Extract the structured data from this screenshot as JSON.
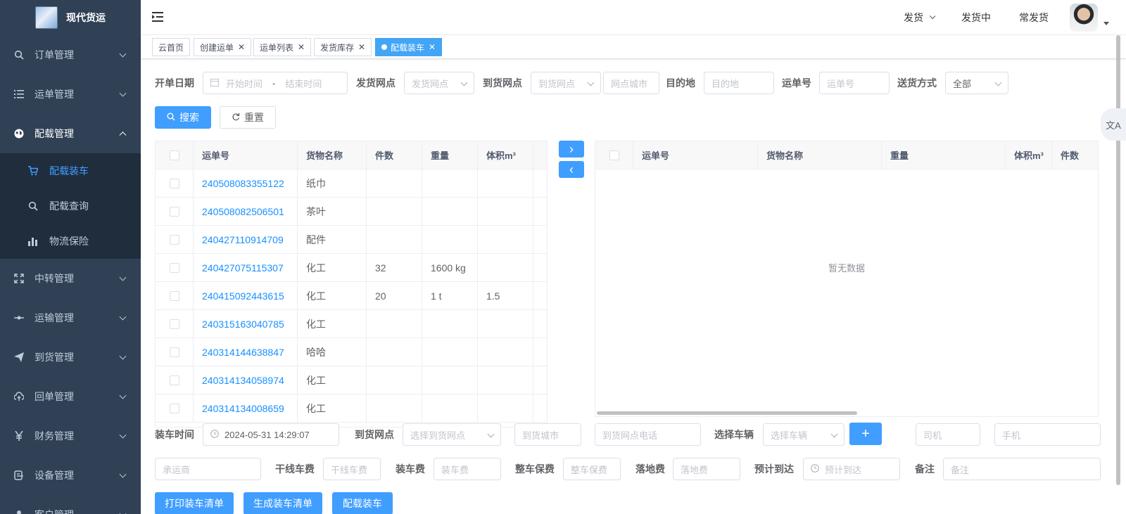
{
  "app": {
    "title": "现代货运"
  },
  "sidebar": {
    "items": [
      {
        "label": "订单管理",
        "icon": "search-icon"
      },
      {
        "label": "运单管理",
        "icon": "list-icon"
      },
      {
        "label": "配载管理",
        "icon": "globe-icon",
        "open": true,
        "children": [
          {
            "label": "配载装车",
            "icon": "cart-icon",
            "active": true
          },
          {
            "label": "配载查询",
            "icon": "search-icon"
          },
          {
            "label": "物流保险",
            "icon": "bar-chart-icon"
          }
        ]
      },
      {
        "label": "中转管理",
        "icon": "expand-icon"
      },
      {
        "label": "运输管理",
        "icon": "commit-icon"
      },
      {
        "label": "到货管理",
        "icon": "send-icon"
      },
      {
        "label": "回单管理",
        "icon": "cloud-return-icon"
      },
      {
        "label": "财务管理",
        "icon": "yen-icon"
      },
      {
        "label": "设备管理",
        "icon": "device-icon"
      },
      {
        "label": "客户管理",
        "icon": "user-icon"
      }
    ]
  },
  "navbar": {
    "links": [
      "发货",
      "发货中",
      "常发货"
    ]
  },
  "tags": [
    "云首页",
    "创建运单",
    "运单列表",
    "发货库存",
    "配载装车"
  ],
  "filters": {
    "date_label": "开单日期",
    "start_placeholder": "开始时间",
    "date_separator": "-",
    "end_placeholder": "结束时间",
    "send_point_label": "发货网点",
    "send_point_placeholder": "发货网点",
    "arrive_point_label": "到货网点",
    "arrive_point_placeholder": "到货网点",
    "point_city_placeholder": "网点城市",
    "dest_label": "目的地",
    "dest_placeholder": "目的地",
    "waybill_label": "运单号",
    "waybill_placeholder": "运单号",
    "delivery_label": "送货方式",
    "delivery_value": "全部",
    "search_btn": "搜索",
    "reset_btn": "重置"
  },
  "left_table": {
    "columns": [
      "运单号",
      "货物名称",
      "件数",
      "重量",
      "体积m³"
    ],
    "rows": [
      [
        "240508083355122",
        "纸巾",
        "",
        "",
        ""
      ],
      [
        "240508082506501",
        "茶叶",
        "",
        "",
        ""
      ],
      [
        "240427110914709",
        "配件",
        "",
        "",
        ""
      ],
      [
        "240427075115307",
        "化工",
        "32",
        "1600 kg",
        ""
      ],
      [
        "240415092443615",
        "化工",
        "20",
        "1 t",
        "1.5"
      ],
      [
        "240315163040785",
        "化工",
        "",
        "",
        ""
      ],
      [
        "240314144638847",
        "哈哈",
        "",
        "",
        ""
      ],
      [
        "240314134058974",
        "化工",
        "",
        "",
        ""
      ],
      [
        "240314134008659",
        "化工",
        "",
        "",
        ""
      ]
    ]
  },
  "right_table": {
    "columns": [
      "运单号",
      "货物名称",
      "重量",
      "体积m³",
      "件数"
    ],
    "empty_text": "暂无数据"
  },
  "transfer": {
    "right": "›",
    "left": "‹"
  },
  "load_form": {
    "load_time_label": "装车时间",
    "load_time_value": "2024-05-31 14:29:07",
    "arrive_point_label": "到货网点",
    "arrive_point_placeholder": "选择到货网点",
    "arrive_city_placeholder": "到货城市",
    "arrive_phone_placeholder": "到货网点电话",
    "vehicle_label": "选择车辆",
    "vehicle_placeholder": "选择车辆",
    "add_btn": "+",
    "driver_placeholder": "司机",
    "phone_placeholder": "手机",
    "carrier_placeholder": "承运商",
    "trunk_fee_label": "干线车费",
    "trunk_fee_placeholder": "干线车费",
    "load_fee_label": "装车费",
    "load_fee_placeholder": "装车费",
    "insurance_label": "整车保费",
    "insurance_placeholder": "整车保费",
    "landing_fee_label": "落地费",
    "landing_fee_placeholder": "落地费",
    "eta_label": "预计到达",
    "eta_placeholder": "预计到达",
    "remark_label": "备注",
    "remark_placeholder": "备注"
  },
  "actions": [
    "打印装车清单",
    "生成装车清单",
    "配载装车"
  ],
  "translate_icon": "文A"
}
